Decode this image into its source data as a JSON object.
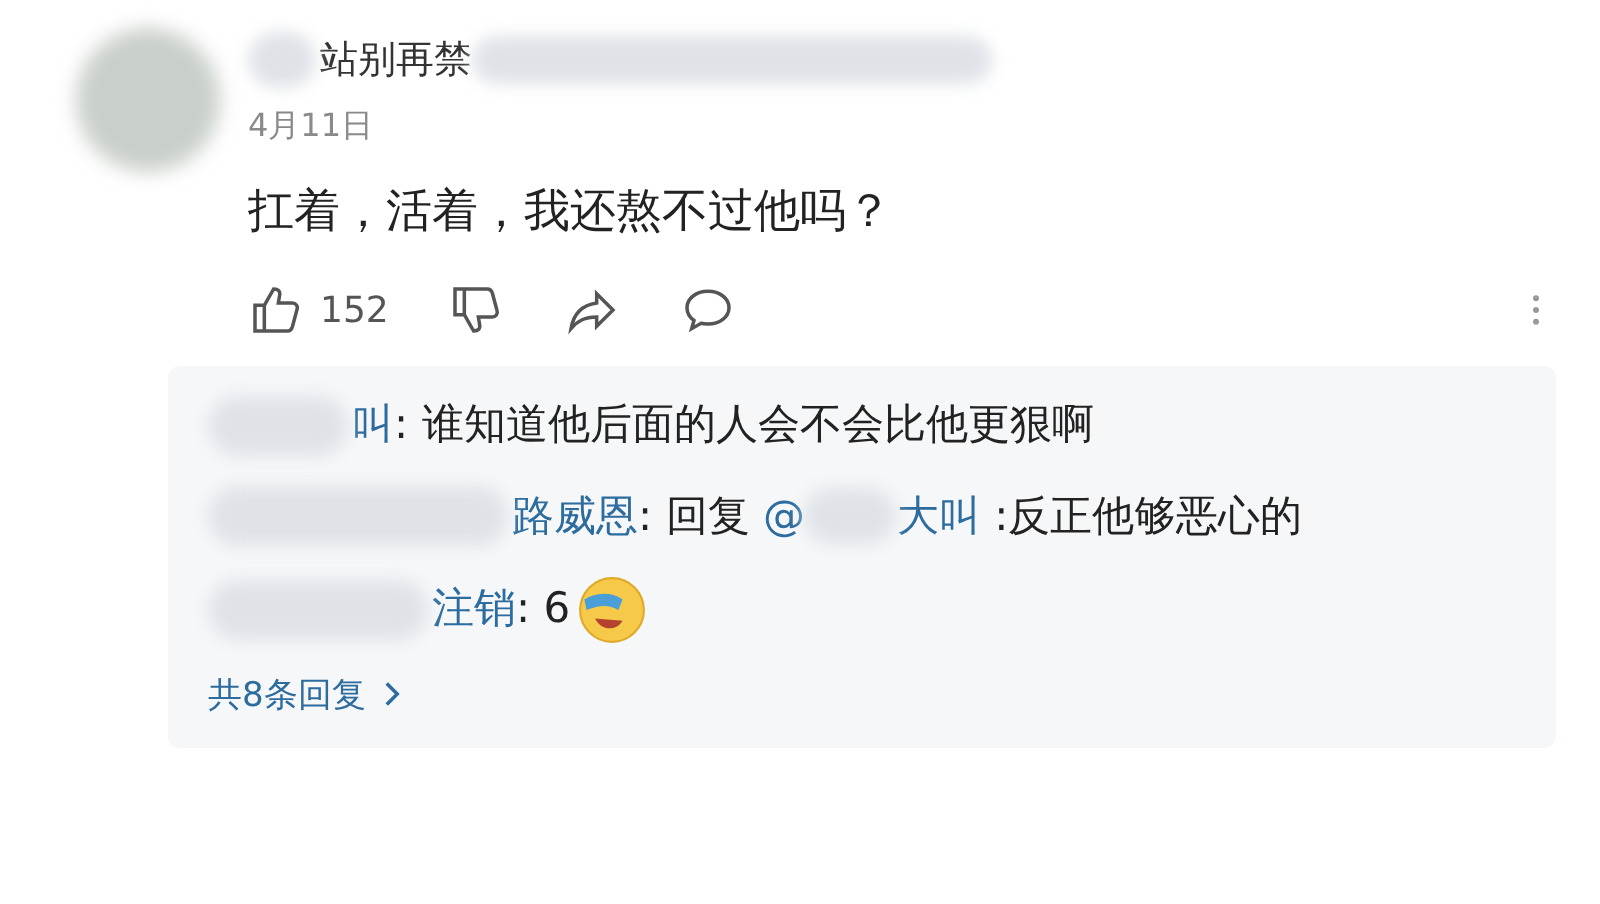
{
  "comment": {
    "author": "站别再禁",
    "date": "4月11日",
    "text": "扛着，活着，我还熬不过他吗？",
    "likes": "152"
  },
  "replies": [
    {
      "author": "叫",
      "text": ": 谁知道他后面的人会不会比他更狠啊"
    },
    {
      "author": "路威恩",
      "reply_label": ": 回复",
      "mention": "@",
      "mention_tail": "大叫",
      "text": " :反正他够恶心的"
    },
    {
      "author": "注销",
      "text": ": 6",
      "emoji": true
    }
  ],
  "more_replies": "共8条回复"
}
